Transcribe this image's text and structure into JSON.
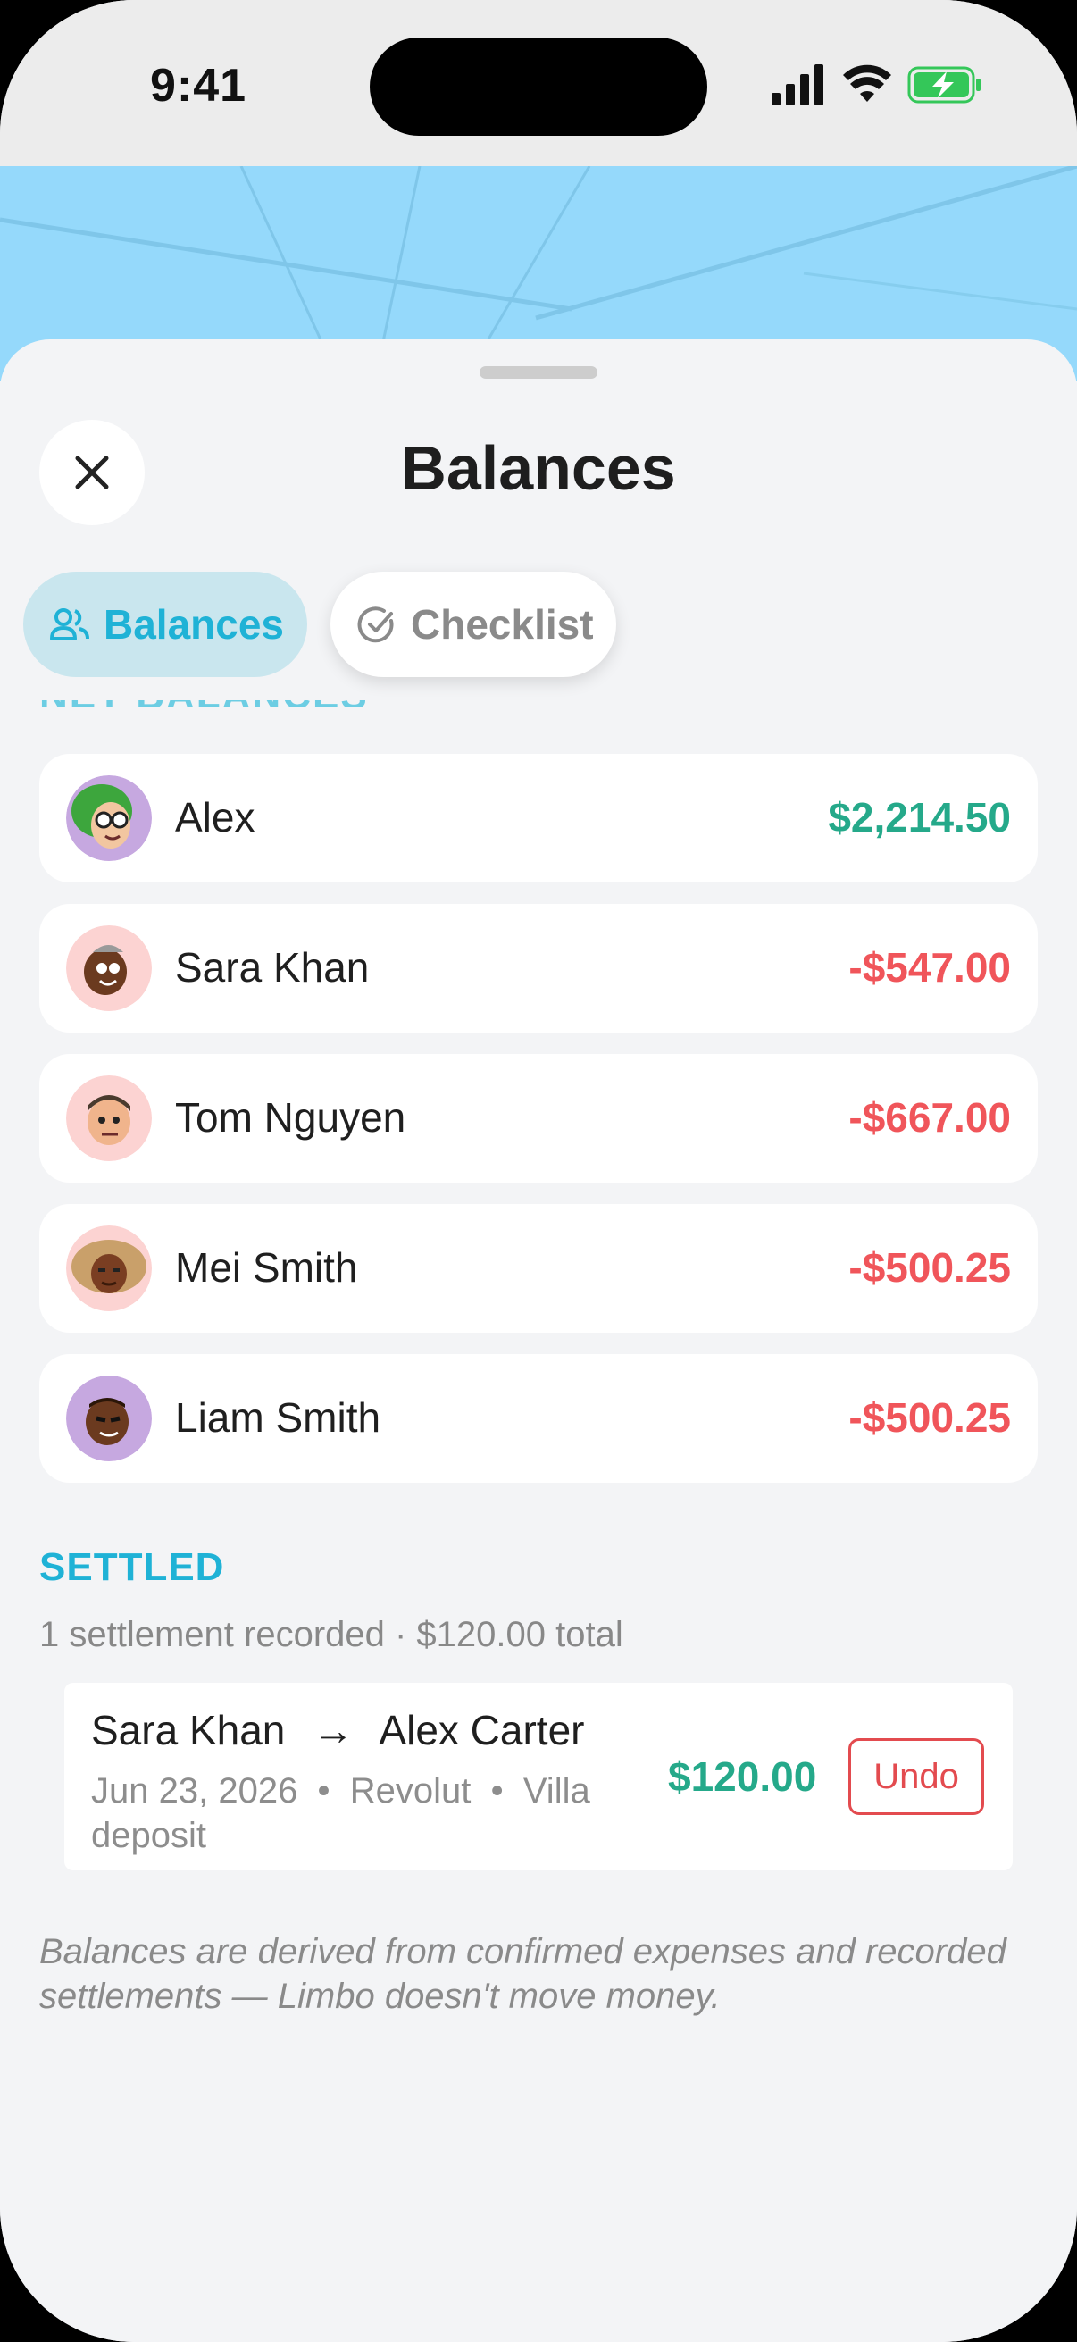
{
  "status_bar": {
    "time": "9:41"
  },
  "sheet": {
    "title": "Balances"
  },
  "tabs": [
    {
      "label": "Balances",
      "icon": "people-icon",
      "active": true
    },
    {
      "label": "Checklist",
      "icon": "check-circle-icon",
      "active": false
    }
  ],
  "clipped_section_header": "NET BALANCES",
  "balances": [
    {
      "name": "Alex",
      "amount": "$2,214.50",
      "sign": "positive",
      "avatar_bg": "#c6a8e0"
    },
    {
      "name": "Sara Khan",
      "amount": "-$547.00",
      "sign": "negative",
      "avatar_bg": "#fcd3d2"
    },
    {
      "name": "Tom Nguyen",
      "amount": "-$667.00",
      "sign": "negative",
      "avatar_bg": "#fcd3d2"
    },
    {
      "name": "Mei Smith",
      "amount": "-$500.25",
      "sign": "negative",
      "avatar_bg": "#fcd3d2"
    },
    {
      "name": "Liam Smith",
      "amount": "-$500.25",
      "sign": "negative",
      "avatar_bg": "#c6a8e0"
    }
  ],
  "settled": {
    "header": "SETTLED",
    "summary": "1 settlement recorded · $120.00 total",
    "item": {
      "from": "Sara Khan",
      "arrow": "→",
      "to": "Alex Carter",
      "meta": "Jun 23, 2026  •  Revolut  •  Villa deposit",
      "amount": "$120.00",
      "undo_label": "Undo"
    }
  },
  "footnote": "Balances are derived from confirmed expenses and recorded settlements — Limbo doesn't move money.",
  "colors": {
    "accent": "#1fb2d6",
    "positive": "#25a98a",
    "negative": "#f0555a"
  }
}
